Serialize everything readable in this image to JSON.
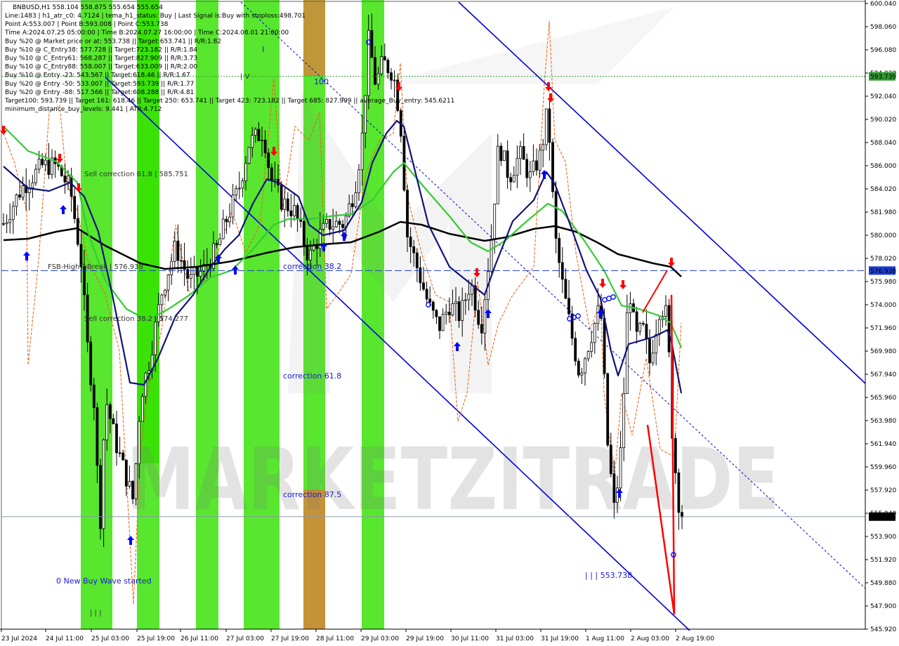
{
  "header": {
    "symbol_line": "BNBUSD,H1  558.104 558.875 555.654 555.654",
    "lines": [
      "Line:1483 | h1_atr_c0: 4.7124 | tema_h1_status: Buy | Last Signal is:Buy with stoploss:498.701",
      "Point A:553.007 | Point B:593.008 | Point C:553.738",
      "Time A:2024.07.25 05:00:00 | Time B:2024.07.27 16:00:00 | Time C:2024.08.01 21:00:00",
      "Buy %20 @ Market price or at: 553.738 || Target:653.741 || R/R:1.82",
      "Buy %10 @ C_Entry38: 577.728 || Target:723.182 || R/R:1.84",
      "Buy %10 @ C_Entry61: 568.287 || Target:827.909 || R/R:3.73",
      "Buy %10 @ C_Entry88: 558.007 || Target:633.009 || R/R:2.00",
      "Buy %10 @ Entry -23: 543.567 || Target:618.46 || R/R:1.67",
      "Buy %20 @ Entry -50: 533.007 || Target:593.739 || R/R:1.77",
      "Buy %20 @ Entry -88: 517.566 || Target:608.288 || R/R:4.81",
      "Target100: 593.739 || Target 161: 618.46 || Target 250: 653.741 || Target 423: 723.182 || Target 685: 827.909 || average_Buy_entry: 545.6211",
      "minimum_distance_buy_levels: 9.441 | ATR:4.712"
    ]
  },
  "annotations": {
    "sell_618": "Sell correction 61.8 | 585.751",
    "sell_382": "Sell correction 38.2 | 574.277",
    "fsb": "FSB-HighToBreak | 576.938",
    "corr382": "correction 38.2",
    "corr618": "correction 61.8",
    "corr875": "correction 87.5",
    "new_wave": "0 New Buy Wave started",
    "point_c": "| | | 553.738",
    "label_100": "100",
    "label_iv": "| V",
    "label_i": "I",
    "label_iii_small": "| | |"
  },
  "price_tags": {
    "target100": "593.739",
    "fsb": "576.938",
    "current": "555.654"
  },
  "watermark": "MARKETZITRADE",
  "colors": {
    "background": "#ffffff",
    "green_band": "#33e000",
    "orange_band": "#d2883a",
    "ema_green": "#33cc33",
    "ema_navy": "#12127a",
    "sma_black": "#000000",
    "channel_blue": "#0000dd",
    "stoploss_orange": "#f06010",
    "buy_arrow": "#0000ff",
    "sell_arrow": "#ff0000",
    "fsb_line": "#1e3cd2",
    "target_line": "#2e9a2e"
  },
  "chart_data": {
    "type": "candlestick",
    "symbol": "BNBUSD",
    "timeframe": "H1",
    "ylim": [
      545.92,
      600.04
    ],
    "y_ticks": [
      "600.040",
      "598.060",
      "596.080",
      "594.020",
      "592.040",
      "590.020",
      "588.040",
      "586.000",
      "584.020",
      "581.980",
      "580.000",
      "578.020",
      "575.980",
      "574.000",
      "571.960",
      "569.980",
      "567.940",
      "565.960",
      "563.980",
      "561.940",
      "559.960",
      "557.920",
      "555.940",
      "553.900",
      "551.920",
      "549.880",
      "547.900",
      "545.920"
    ],
    "x_ticks": [
      "23 Jul 2024",
      "24 Jul 11:00",
      "25 Jul 03:00",
      "25 Jul 19:00",
      "26 Jul 11:00",
      "27 Jul 03:00",
      "27 Jul 19:00",
      "28 Jul 11:00",
      "29 Jul 03:00",
      "29 Jul 19:00",
      "30 Jul 11:00",
      "31 Jul 03:00",
      "31 Jul 19:00",
      "1 Aug 11:00",
      "2 Aug 03:00",
      "2 Aug 19:00"
    ],
    "levels": {
      "target100": 593.739,
      "fsb_high_to_break": 576.938,
      "current": 555.654
    },
    "last_close": 555.654
  }
}
